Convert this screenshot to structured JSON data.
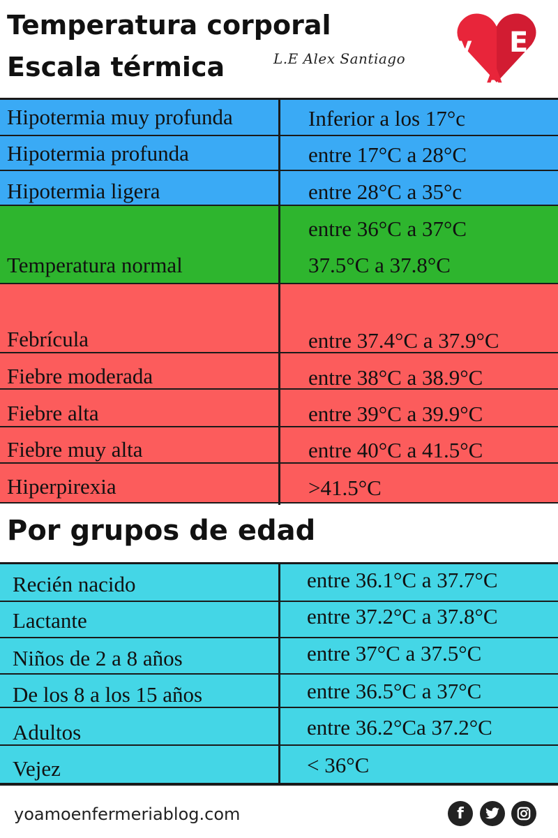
{
  "header": {
    "title_line1": "Temperatura corporal",
    "title_line2": "Escala térmica",
    "author": "L.E Alex Santiago",
    "logo_letters": [
      "y",
      "A",
      "E"
    ]
  },
  "scale_rows": [
    {
      "label": "Hipotermia muy profunda",
      "value": "Inferior a los 17°c",
      "category": "hypothermia"
    },
    {
      "label": "Hipotermia profunda",
      "value": "entre 17°C a 28°C",
      "category": "hypothermia"
    },
    {
      "label": "Hipotermia ligera",
      "value": "entre 28°C a 35°c",
      "category": "hypothermia"
    },
    {
      "label": "Temperatura normal",
      "values": [
        "entre 36°C a 37°C",
        "37.5°C a 37.8°C"
      ],
      "category": "normal"
    },
    {
      "label": "Febrícula",
      "value": "entre 37.4°C a 37.9°C",
      "category": "fever"
    },
    {
      "label": "Fiebre moderada",
      "value": "entre 38°C a 38.9°C",
      "category": "fever"
    },
    {
      "label": "Fiebre alta",
      "value": "entre 39°C a 39.9°C",
      "category": "fever"
    },
    {
      "label": "Fiebre muy alta",
      "value": "entre 40°C a 41.5°C",
      "category": "fever"
    },
    {
      "label": "Hiperpirexia",
      "value": ">41.5°C",
      "category": "fever"
    }
  ],
  "age_section": {
    "heading": "Por grupos de edad",
    "rows": [
      {
        "label": "Recién nacido",
        "value": "entre 36.1°C a 37.7°C"
      },
      {
        "label": "Lactante",
        "value": "entre 37.2°C a 37.8°C"
      },
      {
        "label": "Niños de 2 a 8 años",
        "value": "entre 37°C a 37.5°C"
      },
      {
        "label": "De los 8 a los 15 años",
        "value": "entre 36.5°C a 37°C"
      },
      {
        "label": "Adultos",
        "value": "entre 36.2°Ca 37.2°C"
      },
      {
        "label": "Vejez",
        "value": "< 36°C"
      }
    ]
  },
  "footer": {
    "url": "yoamoenfermeriablog.com",
    "social_icons": [
      "facebook-icon",
      "twitter-icon",
      "instagram-icon"
    ]
  },
  "colors": {
    "hypothermia": "#3aaaf5",
    "normal": "#2eb52e",
    "fever": "#fc5c5c",
    "age": "#44d6e6",
    "logo": "#e8253a"
  }
}
